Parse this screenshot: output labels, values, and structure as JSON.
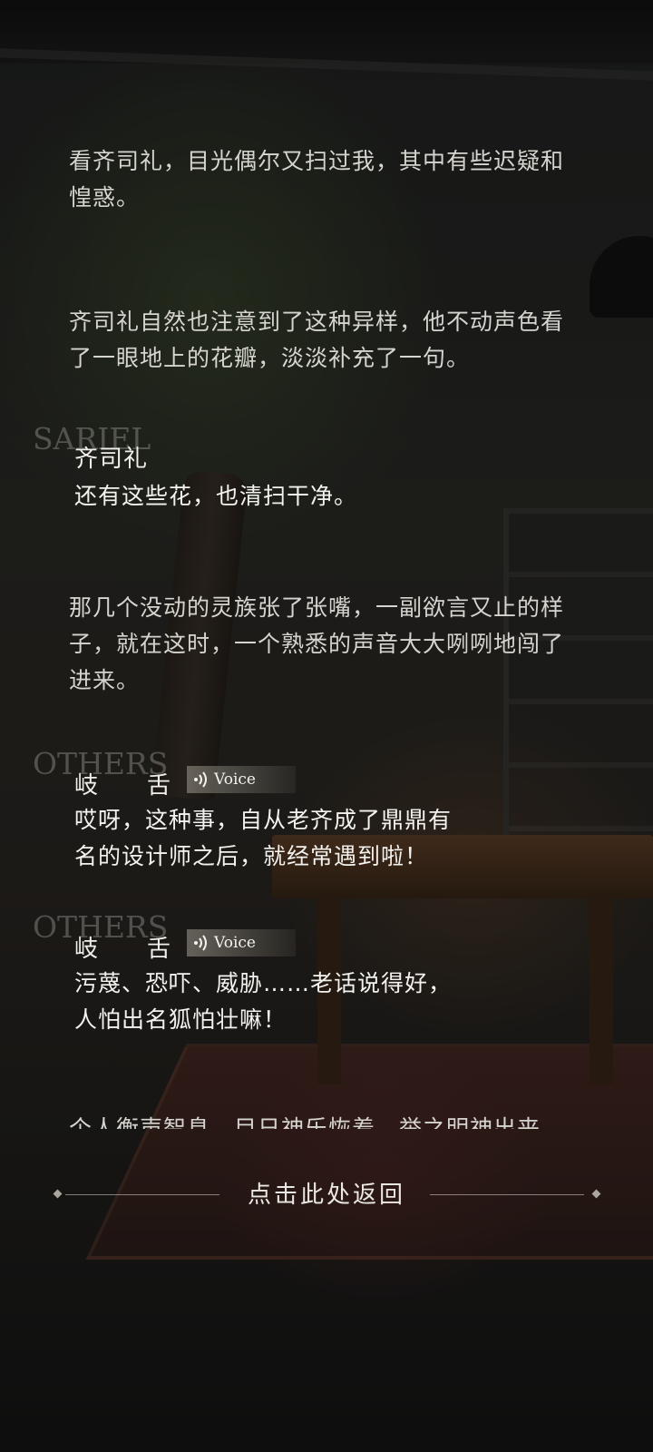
{
  "narrations": [
    "看齐司礼，目光偶尔又扫过我，其中有些迟疑和惶惑。",
    "齐司礼自然也注意到了这种异样，他不动声色看了一眼地上的花瓣，淡淡补充了一句。",
    "那几个没动的灵族张了张嘴，一副欲言又止的样子，就在这时，一个熟悉的声音大大咧咧地闯了进来。"
  ],
  "dialogues": [
    {
      "tag": "SARIEL",
      "speaker": "齐司礼",
      "text": "还有这些花，也清扫干净。"
    },
    {
      "tag": "OTHERS",
      "speaker": "岐舌",
      "voice_label": "Voice",
      "lines": [
        "哎呀，这种事，自从老齐成了鼎鼎有",
        "名的设计师之后，就经常遇到啦！"
      ]
    },
    {
      "tag": "OTHERS",
      "speaker": "岐舌",
      "voice_label": "Voice",
      "lines": [
        "污蔑、恐吓、威胁……老话说得好，",
        "人怕出名狐怕壮嘛！"
      ]
    }
  ],
  "partial_next_line": "个人衡声智息，目日神乐恢着，举之明神出来",
  "return_button": {
    "label": "点击此处返回"
  },
  "icons": {
    "voice": "speaker-waves-icon",
    "divider": "diamond-icon"
  }
}
